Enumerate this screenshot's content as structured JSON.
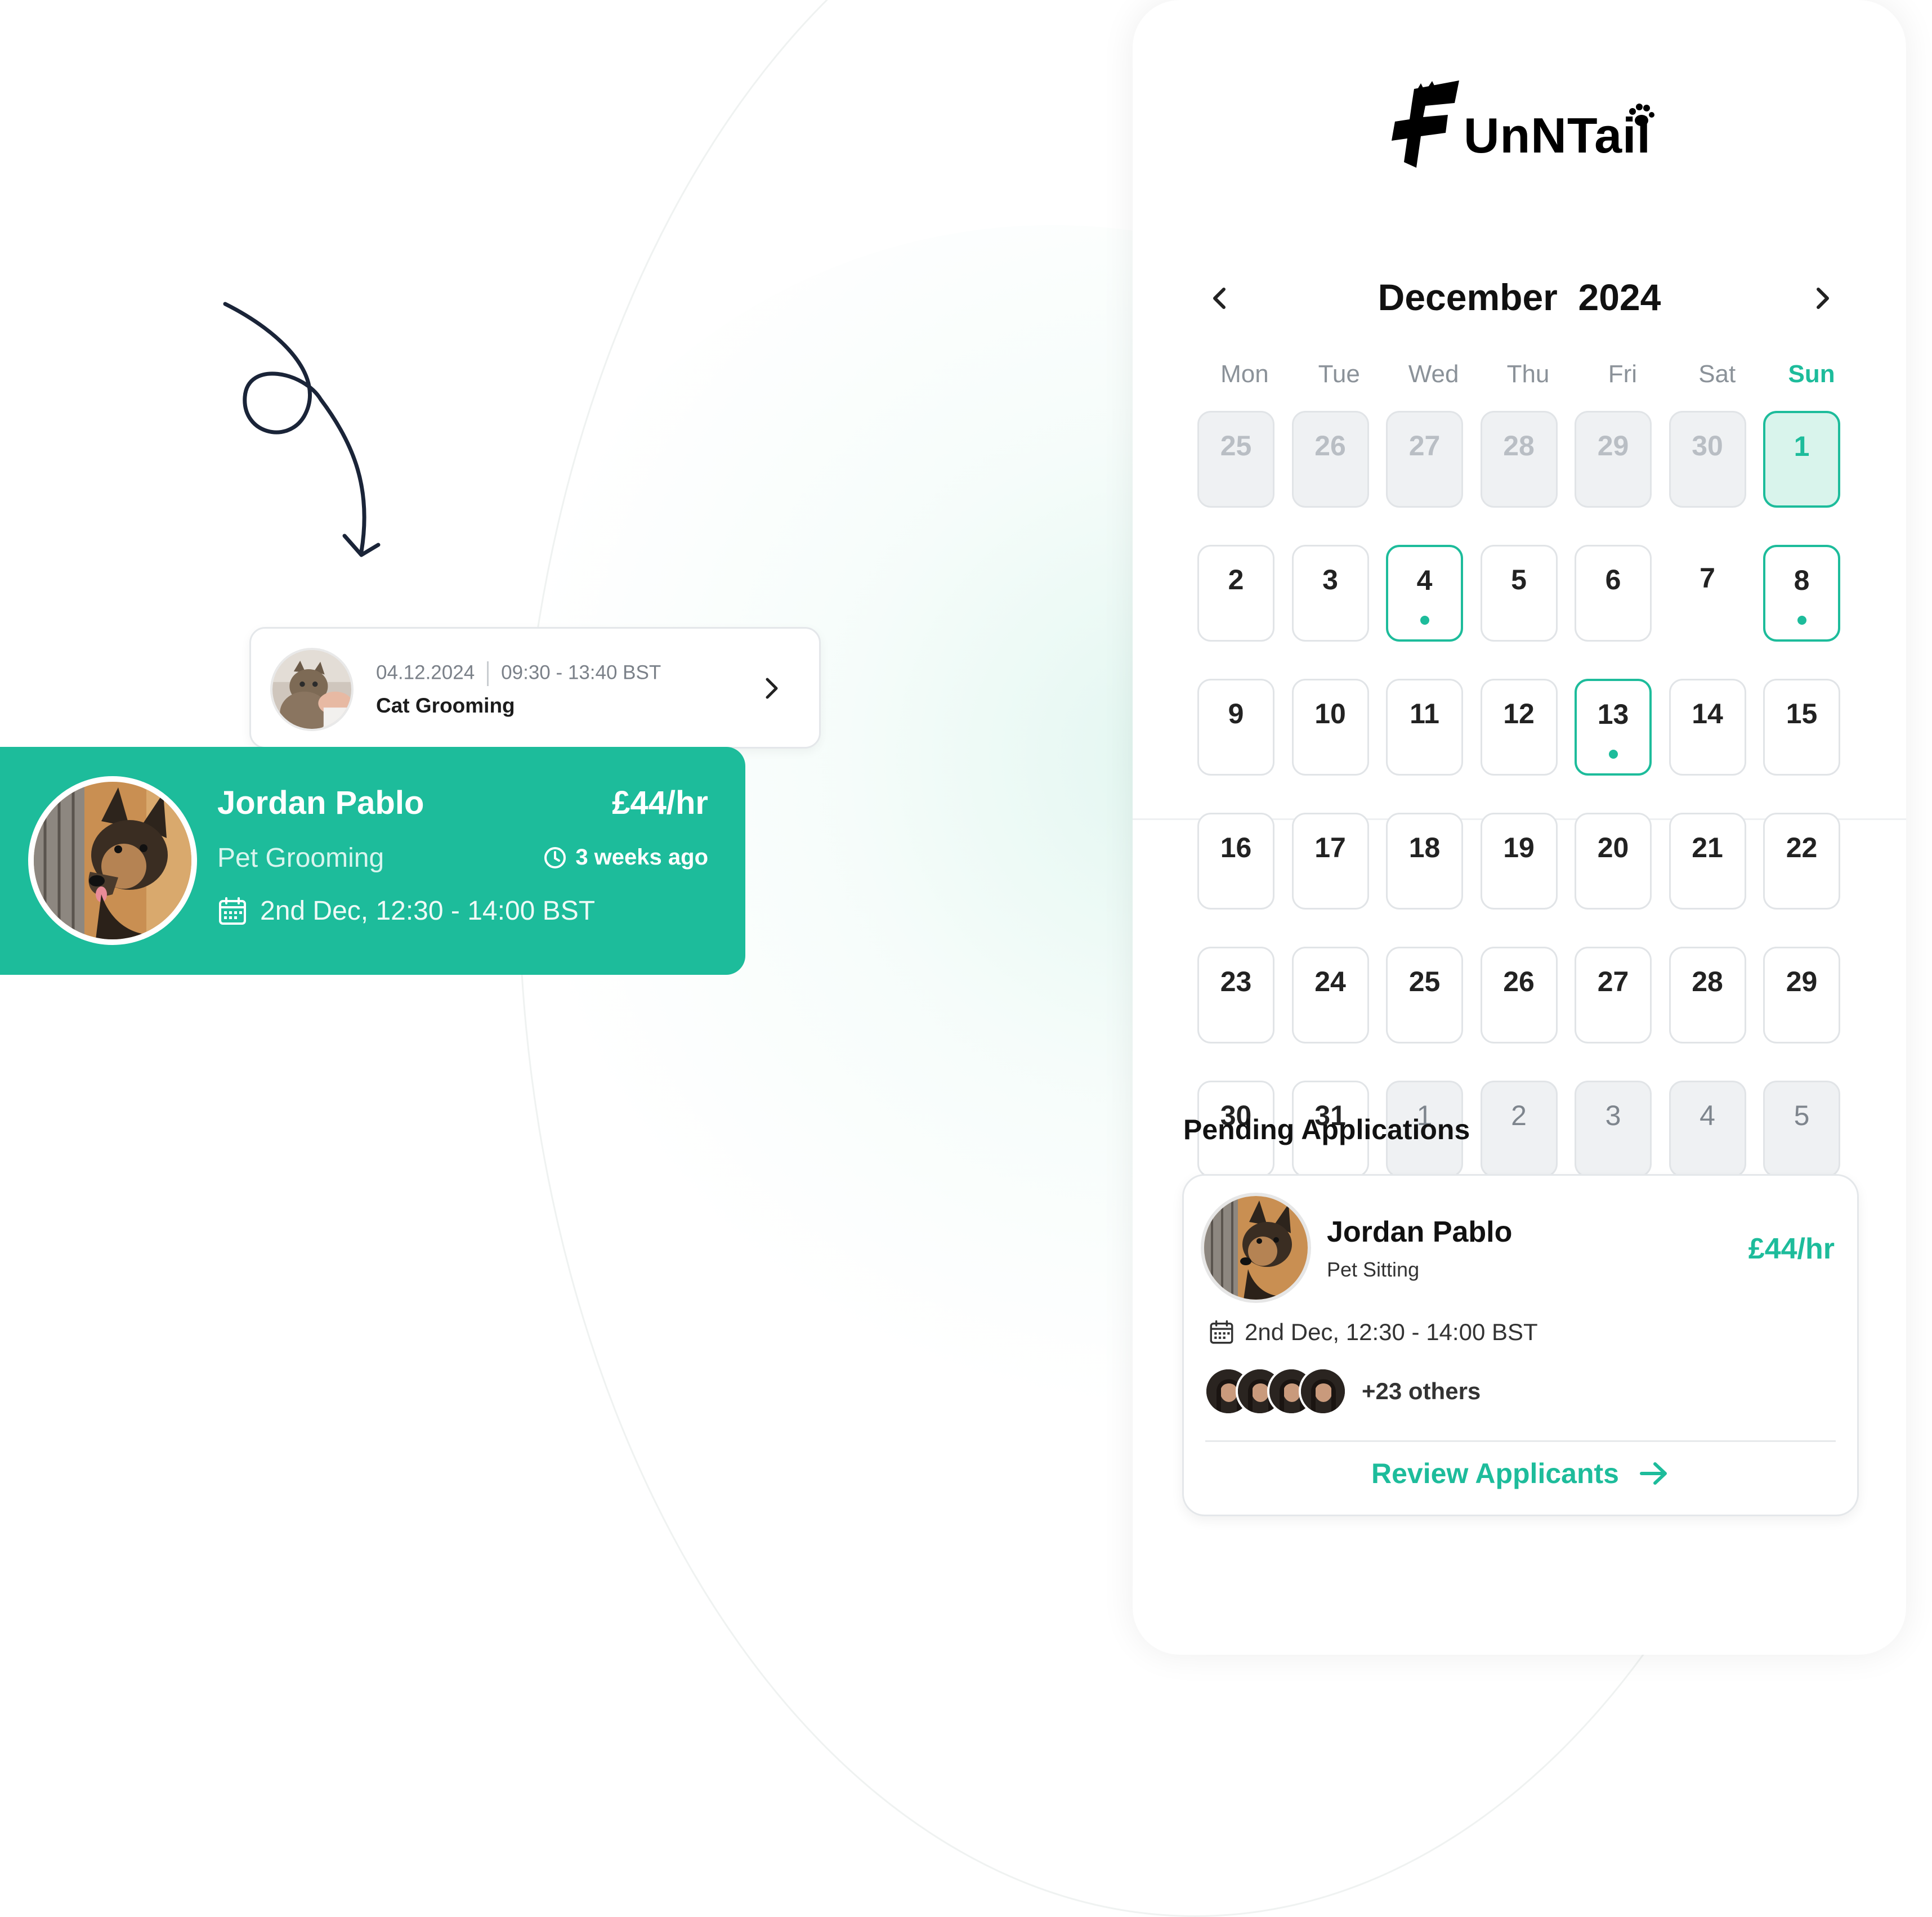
{
  "app": {
    "brand": "UnNTail"
  },
  "appointment_card": {
    "date": "04.12.2024",
    "time": "09:30 - 13:40 BST",
    "service": "Cat Grooming",
    "avatar_icon": "cat-photo"
  },
  "job_card": {
    "name": "Jordan Pablo",
    "rate": "£44/hr",
    "service": "Pet Grooming",
    "posted": "3 weeks ago",
    "schedule": "2nd Dec, 12:30 - 14:00 BST",
    "accent": "#1dbc9b"
  },
  "calendar": {
    "month": "December",
    "year": "2024",
    "weekdays": [
      "Mon",
      "Tue",
      "Wed",
      "Thu",
      "Fri",
      "Sat",
      "Sun"
    ],
    "days": [
      {
        "label": "25",
        "state": "prev"
      },
      {
        "label": "26",
        "state": "prev"
      },
      {
        "label": "27",
        "state": "prev"
      },
      {
        "label": "28",
        "state": "prev"
      },
      {
        "label": "29",
        "state": "prev"
      },
      {
        "label": "30",
        "state": "prev"
      },
      {
        "label": "1",
        "state": "today"
      },
      {
        "label": "2",
        "state": "normal"
      },
      {
        "label": "3",
        "state": "normal"
      },
      {
        "label": "4",
        "state": "event"
      },
      {
        "label": "5",
        "state": "normal"
      },
      {
        "label": "6",
        "state": "normal"
      },
      {
        "label": "7",
        "state": "plain"
      },
      {
        "label": "8",
        "state": "event"
      },
      {
        "label": "9",
        "state": "normal"
      },
      {
        "label": "10",
        "state": "normal"
      },
      {
        "label": "11",
        "state": "normal"
      },
      {
        "label": "12",
        "state": "normal"
      },
      {
        "label": "13",
        "state": "event"
      },
      {
        "label": "14",
        "state": "normal"
      },
      {
        "label": "15",
        "state": "normal"
      },
      {
        "label": "16",
        "state": "normal"
      },
      {
        "label": "17",
        "state": "normal"
      },
      {
        "label": "18",
        "state": "normal"
      },
      {
        "label": "19",
        "state": "normal"
      },
      {
        "label": "20",
        "state": "normal"
      },
      {
        "label": "21",
        "state": "normal"
      },
      {
        "label": "22",
        "state": "normal"
      },
      {
        "label": "23",
        "state": "normal"
      },
      {
        "label": "24",
        "state": "normal"
      },
      {
        "label": "25",
        "state": "normal"
      },
      {
        "label": "26",
        "state": "normal"
      },
      {
        "label": "27",
        "state": "normal"
      },
      {
        "label": "28",
        "state": "normal"
      },
      {
        "label": "29",
        "state": "normal"
      },
      {
        "label": "30",
        "state": "normal"
      },
      {
        "label": "31",
        "state": "normal"
      },
      {
        "label": "1",
        "state": "next"
      },
      {
        "label": "2",
        "state": "next"
      },
      {
        "label": "3",
        "state": "next"
      },
      {
        "label": "4",
        "state": "next"
      },
      {
        "label": "5",
        "state": "next"
      }
    ]
  },
  "pending": {
    "title": "Pending Applications",
    "name": "Jordan Pablo",
    "service": "Pet Sitting",
    "rate": "£44/hr",
    "schedule": "2nd Dec, 12:30 - 14:00 BST",
    "others": "+23 others",
    "cta": "Review Applicants"
  }
}
